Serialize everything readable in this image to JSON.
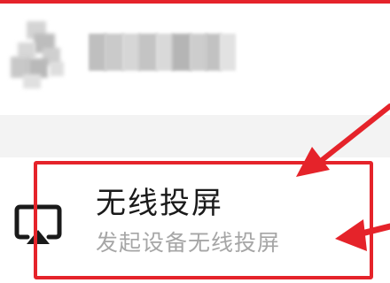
{
  "menu": {
    "item": {
      "title": "无线投屏",
      "subtitle": "发起设备无线投屏",
      "icon": "screen-cast-icon"
    }
  },
  "profile": {
    "avatar_icon": "blurred-avatar",
    "name_text": ""
  },
  "annotations": {
    "color": "#e5232a",
    "highlight": "red-box-around-menu-item",
    "arrows": [
      "arrow-pointing-to-title",
      "arrow-pointing-to-subtitle"
    ]
  },
  "colors": {
    "title": "#1a1a1a",
    "subtitle": "#a6a6a6",
    "separator": "#f3f3f3",
    "annotation": "#e5232a"
  }
}
